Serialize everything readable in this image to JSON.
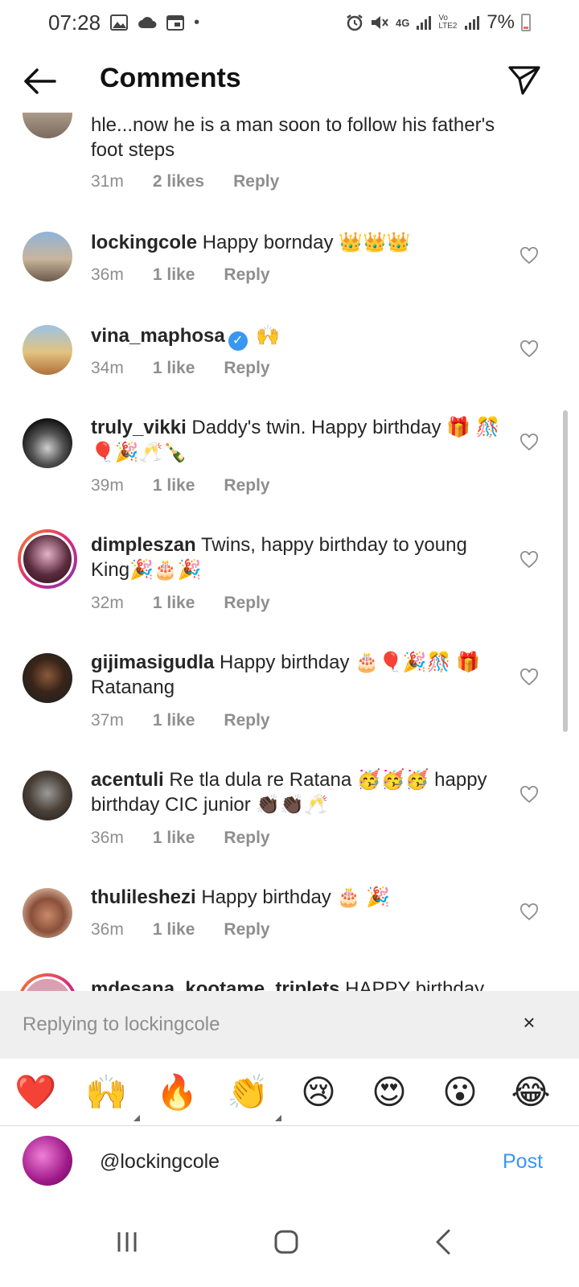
{
  "status": {
    "time": "07:28",
    "battery": "7%",
    "network": "4G",
    "volte": "Vo LTE2"
  },
  "header": {
    "title": "Comments"
  },
  "partial_comment": {
    "text": "hle...now he is a man soon to follow his father's foot steps",
    "time": "31m",
    "likes": "2 likes",
    "reply": "Reply"
  },
  "comments": [
    {
      "user": "lockingcole",
      "text": "Happy bornday 👑👑👑",
      "time": "36m",
      "likes": "1 like",
      "reply": "Reply"
    },
    {
      "user": "vina_maphosa",
      "text": "🙌",
      "time": "34m",
      "likes": "1 like",
      "reply": "Reply"
    },
    {
      "user": "truly_vikki",
      "text": "Daddy's twin. Happy birthday 🎁 🎊🎈🎉🥂🍾",
      "time": "39m",
      "likes": "1 like",
      "reply": "Reply"
    },
    {
      "user": "dimpleszan",
      "text": "Twins, happy birthday to young King🎉🎂🎉",
      "time": "32m",
      "likes": "1 like",
      "reply": "Reply"
    },
    {
      "user": "gijimasigudla",
      "text": "Happy birthday 🎂🎈🎉🎊 🎁 Ratanang",
      "time": "37m",
      "likes": "1 like",
      "reply": "Reply"
    },
    {
      "user": "acentuli",
      "text": "Re tla dula re Ratana 🥳🥳🥳 happy birthday CIC junior 👏🏿👏🏿🥂",
      "time": "36m",
      "likes": "1 like",
      "reply": "Reply"
    },
    {
      "user": "thulileshezi",
      "text": "Happy birthday 🎂 🎉",
      "time": "36m",
      "likes": "1 like",
      "reply": "Reply"
    }
  ],
  "cut_comment": {
    "user": "mdesana_kootame_triplets",
    "text": "HAPPY birthday"
  },
  "replying": {
    "text": "Replying to lockingcole",
    "close": "×"
  },
  "emoji_bar": [
    "❤️",
    "🙌",
    "🔥",
    "👏",
    "😢",
    "😍",
    "😮",
    "😂"
  ],
  "input": {
    "value": "@lockingcole",
    "post_label": "Post"
  },
  "colors": {
    "accent": "#3897f0",
    "meta": "#8e8e8e",
    "reply_bg": "#efefef"
  }
}
